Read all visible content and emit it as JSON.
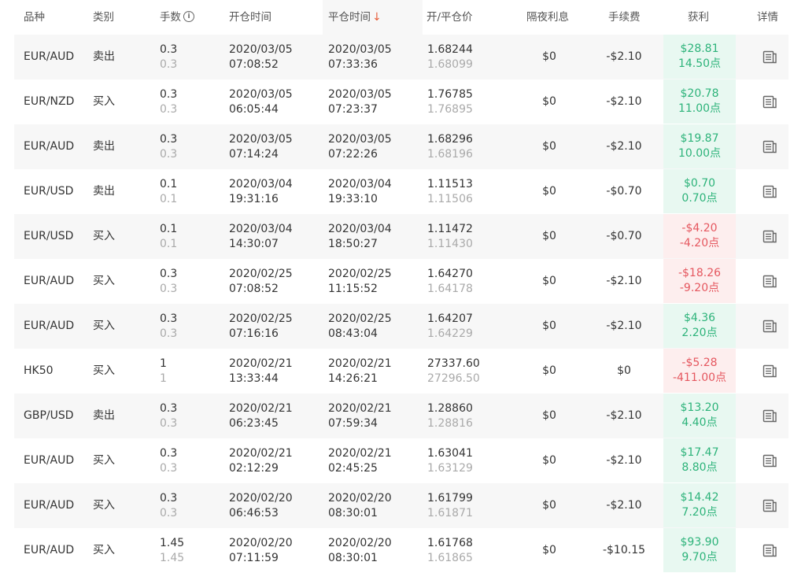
{
  "header": {
    "symbol": "品种",
    "type": "类别",
    "lots": "手数",
    "open_time": "开仓时间",
    "close_time": "平仓时间",
    "price": "开/平仓价",
    "swap": "隔夜利息",
    "fee": "手续费",
    "profit": "获利",
    "detail": "详情"
  },
  "icons": {
    "lots_info": "info-icon",
    "sort": "arrow-down-icon",
    "detail": "document-icon"
  },
  "colors": {
    "profit_positive": "#2db37a",
    "profit_negative": "#e5575f",
    "sort_arrow": "#e8603c"
  },
  "rows": [
    {
      "symbol": "EUR/AUD",
      "type": "卖出",
      "lots": "0.3",
      "lots2": "0.3",
      "open_date": "2020/03/05",
      "open_time": "07:08:52",
      "close_date": "2020/03/05",
      "close_time": "07:33:36",
      "open_price": "1.68244",
      "close_price": "1.68099",
      "swap": "$0",
      "fee": "-$2.10",
      "profit": "$28.81",
      "points": "14.50点",
      "positive": true
    },
    {
      "symbol": "EUR/NZD",
      "type": "买入",
      "lots": "0.3",
      "lots2": "0.3",
      "open_date": "2020/03/05",
      "open_time": "06:05:44",
      "close_date": "2020/03/05",
      "close_time": "07:23:37",
      "open_price": "1.76785",
      "close_price": "1.76895",
      "swap": "$0",
      "fee": "-$2.10",
      "profit": "$20.78",
      "points": "11.00点",
      "positive": true
    },
    {
      "symbol": "EUR/AUD",
      "type": "卖出",
      "lots": "0.3",
      "lots2": "0.3",
      "open_date": "2020/03/05",
      "open_time": "07:14:24",
      "close_date": "2020/03/05",
      "close_time": "07:22:26",
      "open_price": "1.68296",
      "close_price": "1.68196",
      "swap": "$0",
      "fee": "-$2.10",
      "profit": "$19.87",
      "points": "10.00点",
      "positive": true
    },
    {
      "symbol": "EUR/USD",
      "type": "卖出",
      "lots": "0.1",
      "lots2": "0.1",
      "open_date": "2020/03/04",
      "open_time": "19:31:16",
      "close_date": "2020/03/04",
      "close_time": "19:33:10",
      "open_price": "1.11513",
      "close_price": "1.11506",
      "swap": "$0",
      "fee": "-$0.70",
      "profit": "$0.70",
      "points": "0.70点",
      "positive": true
    },
    {
      "symbol": "EUR/USD",
      "type": "买入",
      "lots": "0.1",
      "lots2": "0.1",
      "open_date": "2020/03/04",
      "open_time": "14:30:07",
      "close_date": "2020/03/04",
      "close_time": "18:50:27",
      "open_price": "1.11472",
      "close_price": "1.11430",
      "swap": "$0",
      "fee": "-$0.70",
      "profit": "-$4.20",
      "points": "-4.20点",
      "positive": false
    },
    {
      "symbol": "EUR/AUD",
      "type": "买入",
      "lots": "0.3",
      "lots2": "0.3",
      "open_date": "2020/02/25",
      "open_time": "07:08:52",
      "close_date": "2020/02/25",
      "close_time": "11:15:52",
      "open_price": "1.64270",
      "close_price": "1.64178",
      "swap": "$0",
      "fee": "-$2.10",
      "profit": "-$18.26",
      "points": "-9.20点",
      "positive": false
    },
    {
      "symbol": "EUR/AUD",
      "type": "买入",
      "lots": "0.3",
      "lots2": "0.3",
      "open_date": "2020/02/25",
      "open_time": "07:16:16",
      "close_date": "2020/02/25",
      "close_time": "08:43:04",
      "open_price": "1.64207",
      "close_price": "1.64229",
      "swap": "$0",
      "fee": "-$2.10",
      "profit": "$4.36",
      "points": "2.20点",
      "positive": true
    },
    {
      "symbol": "HK50",
      "type": "买入",
      "lots": "1",
      "lots2": "1",
      "open_date": "2020/02/21",
      "open_time": "13:33:44",
      "close_date": "2020/02/21",
      "close_time": "14:26:21",
      "open_price": "27337.60",
      "close_price": "27296.50",
      "swap": "$0",
      "fee": "$0",
      "profit": "-$5.28",
      "points": "-411.00点",
      "positive": false
    },
    {
      "symbol": "GBP/USD",
      "type": "卖出",
      "lots": "0.3",
      "lots2": "0.3",
      "open_date": "2020/02/21",
      "open_time": "06:23:45",
      "close_date": "2020/02/21",
      "close_time": "07:59:34",
      "open_price": "1.28860",
      "close_price": "1.28816",
      "swap": "$0",
      "fee": "-$2.10",
      "profit": "$13.20",
      "points": "4.40点",
      "positive": true
    },
    {
      "symbol": "EUR/AUD",
      "type": "买入",
      "lots": "0.3",
      "lots2": "0.3",
      "open_date": "2020/02/21",
      "open_time": "02:12:29",
      "close_date": "2020/02/21",
      "close_time": "02:45:25",
      "open_price": "1.63041",
      "close_price": "1.63129",
      "swap": "$0",
      "fee": "-$2.10",
      "profit": "$17.47",
      "points": "8.80点",
      "positive": true
    },
    {
      "symbol": "EUR/AUD",
      "type": "买入",
      "lots": "0.3",
      "lots2": "0.3",
      "open_date": "2020/02/20",
      "open_time": "06:46:53",
      "close_date": "2020/02/20",
      "close_time": "08:30:01",
      "open_price": "1.61799",
      "close_price": "1.61871",
      "swap": "$0",
      "fee": "-$2.10",
      "profit": "$14.42",
      "points": "7.20点",
      "positive": true
    },
    {
      "symbol": "EUR/AUD",
      "type": "买入",
      "lots": "1.45",
      "lots2": "1.45",
      "open_date": "2020/02/20",
      "open_time": "07:11:59",
      "close_date": "2020/02/20",
      "close_time": "08:30:01",
      "open_price": "1.61768",
      "close_price": "1.61865",
      "swap": "$0",
      "fee": "-$10.15",
      "profit": "$93.90",
      "points": "9.70点",
      "positive": true
    }
  ]
}
